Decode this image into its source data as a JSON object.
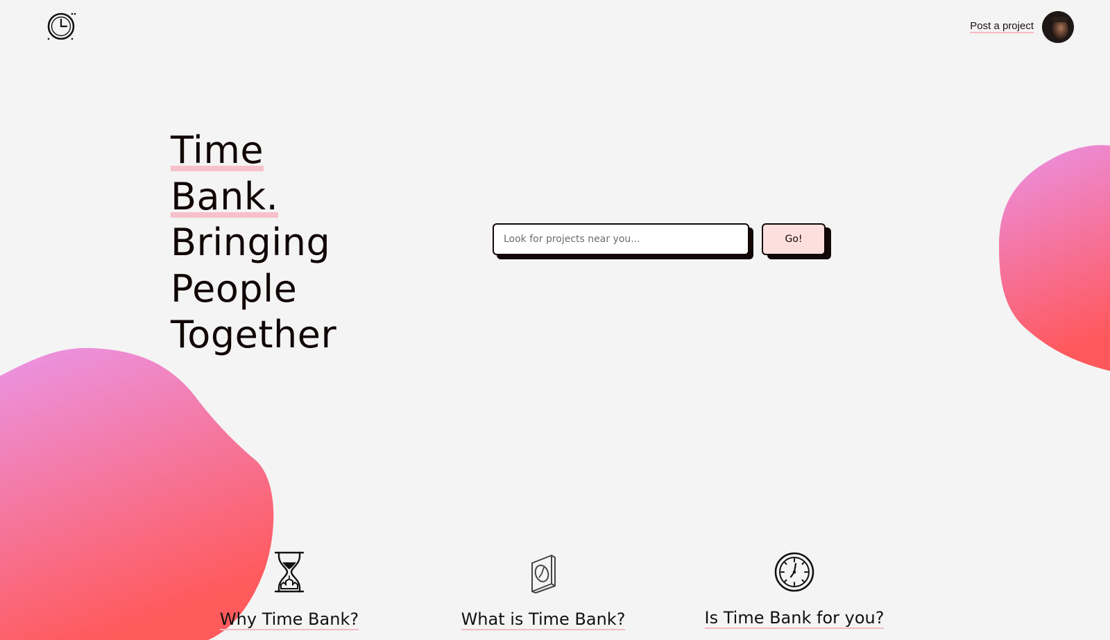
{
  "brand": {
    "logo_icon": "clock-icon"
  },
  "nav": {
    "post_project_label": "Post a project",
    "avatar_alt": "user avatar"
  },
  "hero": {
    "line1": "Time",
    "line2": "Bank.",
    "line3": "Bringing",
    "line4": "People",
    "line5": "Together"
  },
  "search": {
    "placeholder": "Look for projects near you...",
    "value": "",
    "button_label": "Go!"
  },
  "features": [
    {
      "icon": "hourglass-icon",
      "title": "Why Time Bank?"
    },
    {
      "icon": "wall-clock-icon",
      "title": "What is Time Bank?"
    },
    {
      "icon": "clock-icon",
      "title": "Is Time Bank for you?"
    }
  ],
  "colors": {
    "background": "#f4f4f4",
    "text": "#120707",
    "highlight": "#f7c1cb",
    "button_fill": "#fde0dd",
    "blob_gradient_start": "#e98fe3",
    "blob_gradient_end": "#ff5c5c"
  }
}
